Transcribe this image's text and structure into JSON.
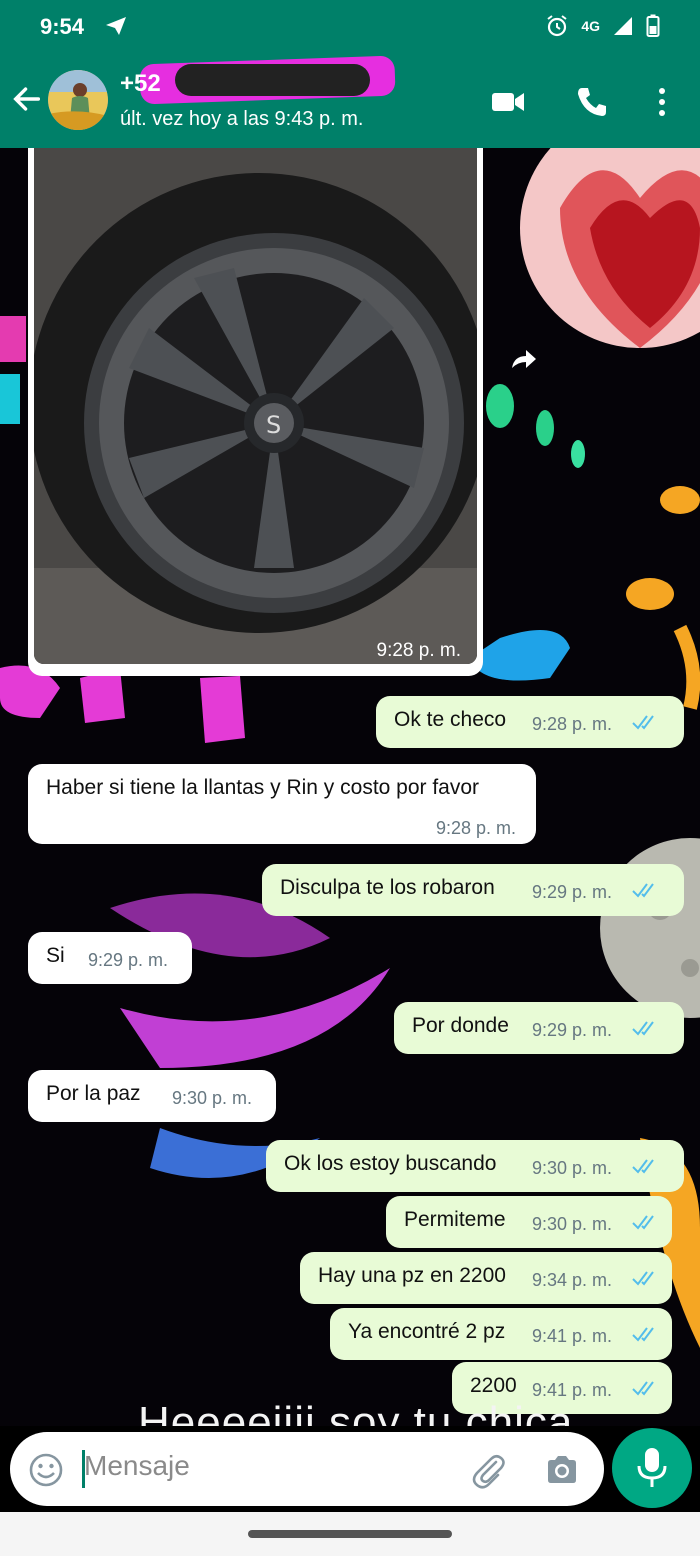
{
  "status_bar": {
    "time": "9:54",
    "network": "4G"
  },
  "header": {
    "contact_name": "+52",
    "last_seen": "últ. vez hoy a las 9:43 p. m."
  },
  "image_message": {
    "time": "9:28 p. m."
  },
  "messages": [
    {
      "dir": "out",
      "text": "Ok te checo",
      "time": "9:28 p. m."
    },
    {
      "dir": "in",
      "text": "Haber si tiene la llantas y Rin y costo por favor",
      "time": "9:28 p. m."
    },
    {
      "dir": "out",
      "text": "Disculpa te los robaron",
      "time": "9:29 p. m."
    },
    {
      "dir": "in",
      "text": "Si",
      "time": "9:29 p. m."
    },
    {
      "dir": "out",
      "text": "Por donde",
      "time": "9:29 p. m."
    },
    {
      "dir": "in",
      "text": "Por la paz",
      "time": "9:30 p. m."
    },
    {
      "dir": "out",
      "text": "Ok los estoy buscando",
      "time": "9:30 p. m."
    },
    {
      "dir": "out",
      "text": "Permiteme",
      "time": "9:30 p. m."
    },
    {
      "dir": "out",
      "text": "Hay una pz en 2200",
      "time": "9:34 p. m."
    },
    {
      "dir": "out",
      "text": "Ya encontré 2 pz",
      "time": "9:41 p. m."
    },
    {
      "dir": "out",
      "text": "2200",
      "time": "9:41 p. m."
    }
  ],
  "wallpaper_caption": "Heeeeiiii soy tu chica",
  "input": {
    "placeholder": "Mensaje"
  },
  "colors": {
    "brand": "#008069",
    "outgoing_bubble": "#e8fbd6",
    "incoming_bubble": "#ffffff",
    "read_ticks": "#53bdeb",
    "mic_button": "#00a884"
  },
  "icons": [
    "back-arrow-icon",
    "video-call-icon",
    "phone-call-icon",
    "more-vert-icon",
    "forward-icon",
    "emoji-icon",
    "attach-icon",
    "camera-icon",
    "mic-icon",
    "telegram-send-icon",
    "alarm-icon",
    "signal-icon",
    "battery-icon"
  ]
}
